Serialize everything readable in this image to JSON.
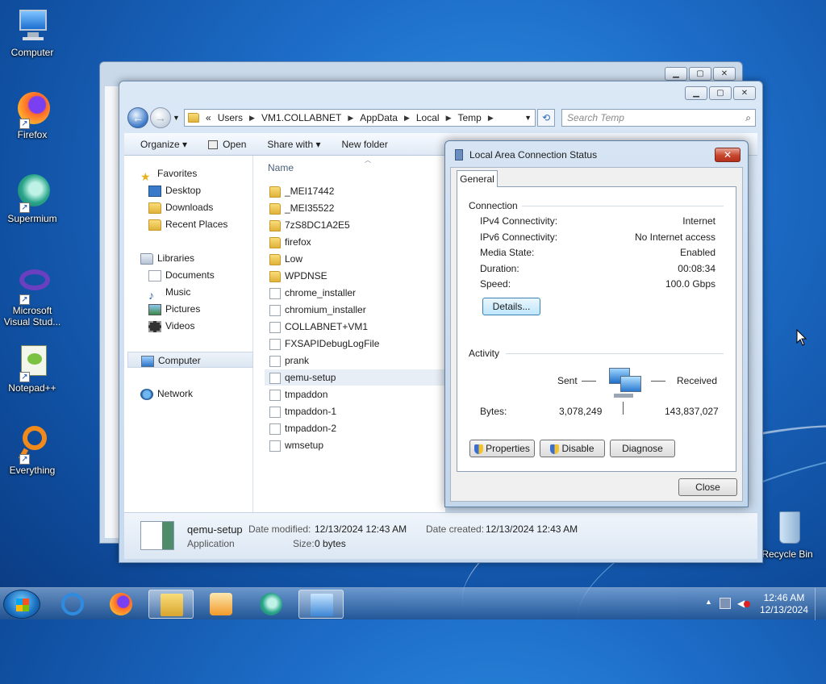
{
  "desktop": {
    "icons": [
      {
        "label": "Computer"
      },
      {
        "label": "Firefox"
      },
      {
        "label": "Supermium"
      },
      {
        "label": "Microsoft Visual Stud..."
      },
      {
        "label": "Notepad++"
      },
      {
        "label": "Everything"
      },
      {
        "label": "Recycle Bin"
      }
    ]
  },
  "explorer": {
    "breadcrumb": [
      "«",
      "Users",
      "VM1.COLLABNET",
      "AppData",
      "Local",
      "Temp"
    ],
    "search_placeholder": "Search Temp",
    "toolbar": {
      "organize": "Organize ▾",
      "open": "Open",
      "share_with": "Share with ▾",
      "new_folder": "New folder"
    },
    "nav": {
      "favorites": "Favorites",
      "desktop": "Desktop",
      "downloads": "Downloads",
      "recent_places": "Recent Places",
      "libraries": "Libraries",
      "documents": "Documents",
      "music": "Music",
      "pictures": "Pictures",
      "videos": "Videos",
      "computer": "Computer",
      "network": "Network"
    },
    "column_name": "Name",
    "files": [
      {
        "name": "_MEI17442",
        "kind": "folder"
      },
      {
        "name": "_MEI35522",
        "kind": "folder"
      },
      {
        "name": "7zS8DC1A2E5",
        "kind": "folder"
      },
      {
        "name": "firefox",
        "kind": "folder"
      },
      {
        "name": "Low",
        "kind": "folder"
      },
      {
        "name": "WPDNSE",
        "kind": "folder"
      },
      {
        "name": "chrome_installer",
        "kind": "file"
      },
      {
        "name": "chromium_installer",
        "kind": "file"
      },
      {
        "name": "COLLABNET+VM1",
        "kind": "file"
      },
      {
        "name": "FXSAPIDebugLogFile",
        "kind": "file"
      },
      {
        "name": "prank",
        "kind": "file"
      },
      {
        "name": "qemu-setup",
        "kind": "file"
      },
      {
        "name": "tmpaddon",
        "kind": "file"
      },
      {
        "name": "tmpaddon-1",
        "kind": "file"
      },
      {
        "name": "tmpaddon-2",
        "kind": "file"
      },
      {
        "name": "wmsetup",
        "kind": "file"
      }
    ],
    "status": {
      "name": "qemu-setup",
      "type": "Application",
      "date_modified_label": "Date modified:",
      "date_modified": "12/13/2024 12:43 AM",
      "date_created_label": "Date created:",
      "date_created": "12/13/2024 12:43 AM",
      "size_label": "Size:",
      "size": "0 bytes"
    }
  },
  "dialog": {
    "title": "Local Area Connection Status",
    "tab": "General",
    "connection_label": "Connection",
    "rows": [
      {
        "label": "IPv4 Connectivity:",
        "value": "Internet"
      },
      {
        "label": "IPv6 Connectivity:",
        "value": "No Internet access"
      },
      {
        "label": "Media State:",
        "value": "Enabled"
      },
      {
        "label": "Duration:",
        "value": "00:08:34"
      },
      {
        "label": "Speed:",
        "value": "100.0 Gbps"
      }
    ],
    "details_button": "Details...",
    "activity_label": "Activity",
    "sent_label": "Sent",
    "received_label": "Received",
    "bytes_label": "Bytes:",
    "bytes_sent": "3,078,249",
    "bytes_received": "143,837,027",
    "properties_button": "Properties",
    "disable_button": "Disable",
    "diagnose_button": "Diagnose",
    "close_button": "Close"
  },
  "taskbar": {
    "time": "12:46 AM",
    "date": "12/13/2024"
  }
}
